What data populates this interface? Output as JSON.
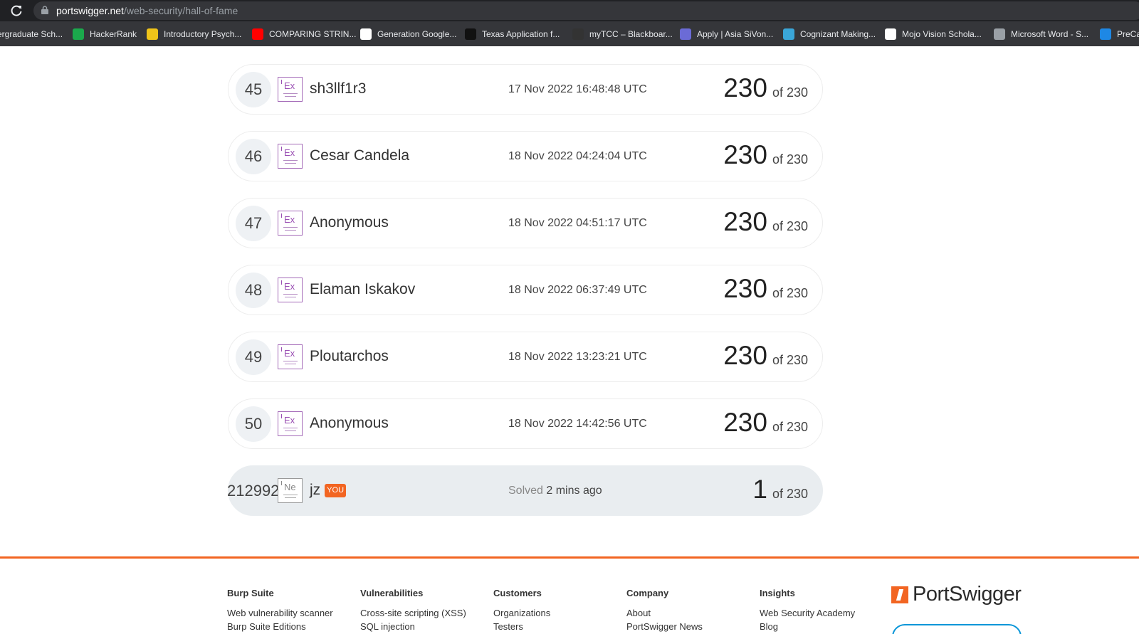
{
  "browser": {
    "url_domain": "portswigger.net",
    "url_path": "/web-security/hall-of-fame",
    "bookmarks": [
      {
        "label": "ergraduate Sch...",
        "icon": "blank-icon"
      },
      {
        "label": "HackerRank",
        "icon": "hackerrank-icon",
        "color": "#1ba94c"
      },
      {
        "label": "Introductory Psych...",
        "icon": "course-icon",
        "color": "#f0c419"
      },
      {
        "label": "COMPARING STRIN...",
        "icon": "youtube-icon",
        "color": "#ff0000"
      },
      {
        "label": "Generation Google...",
        "icon": "google-icon",
        "color": "#ffffff"
      },
      {
        "label": "Texas Application f...",
        "icon": "apply-texas-icon",
        "color": "#111111"
      },
      {
        "label": "myTCC – Blackboar...",
        "icon": "blackboard-icon",
        "color": "#333333"
      },
      {
        "label": "Apply | Asia SiVon...",
        "icon": "globe-icon",
        "color": "#6b6bd6"
      },
      {
        "label": "Cognizant Making...",
        "icon": "grad-cap-icon",
        "color": "#3aa6d8"
      },
      {
        "label": "Mojo Vision Schola...",
        "icon": "mojo-icon",
        "color": "#ffffff"
      },
      {
        "label": "Microsoft Word - S...",
        "icon": "globe-icon",
        "color": "#9aa0a6"
      },
      {
        "label": "PreCa",
        "icon": "onedrive-icon",
        "color": "#1e88e5"
      }
    ]
  },
  "leaderboard": {
    "rows": [
      {
        "rank": "45",
        "level": "Ex",
        "name": "sh3llf1r3",
        "date": "17 Nov 2022 16:48:48 UTC",
        "score": "230",
        "of": "of 230"
      },
      {
        "rank": "46",
        "level": "Ex",
        "name": "Cesar Candela",
        "date": "18 Nov 2022 04:24:04 UTC",
        "score": "230",
        "of": "of 230"
      },
      {
        "rank": "47",
        "level": "Ex",
        "name": "Anonymous",
        "date": "18 Nov 2022 04:51:17 UTC",
        "score": "230",
        "of": "of 230"
      },
      {
        "rank": "48",
        "level": "Ex",
        "name": "Elaman Iskakov",
        "date": "18 Nov 2022 06:37:49 UTC",
        "score": "230",
        "of": "of 230"
      },
      {
        "rank": "49",
        "level": "Ex",
        "name": "Ploutarchos",
        "date": "18 Nov 2022 13:23:21 UTC",
        "score": "230",
        "of": "of 230"
      },
      {
        "rank": "50",
        "level": "Ex",
        "name": "Anonymous",
        "date": "18 Nov 2022 14:42:56 UTC",
        "score": "230",
        "of": "of 230"
      }
    ],
    "you": {
      "rank": "212992",
      "level": "Ne",
      "name": "jz",
      "badge": "YOU",
      "solved_label": "Solved",
      "solved_time": "2 mins ago",
      "score": "1",
      "of": "of 230"
    }
  },
  "footer": {
    "accent": "#f26522",
    "columns": [
      {
        "heading": "Burp Suite",
        "links": [
          "Web vulnerability scanner",
          "Burp Suite Editions"
        ]
      },
      {
        "heading": "Vulnerabilities",
        "links": [
          "Cross-site scripting (XSS)",
          "SQL injection"
        ]
      },
      {
        "heading": "Customers",
        "links": [
          "Organizations",
          "Testers"
        ]
      },
      {
        "heading": "Company",
        "links": [
          "About",
          "PortSwigger News"
        ]
      },
      {
        "heading": "Insights",
        "links": [
          "Web Security Academy",
          "Blog"
        ]
      }
    ],
    "logo_text": "PortSwigger"
  }
}
